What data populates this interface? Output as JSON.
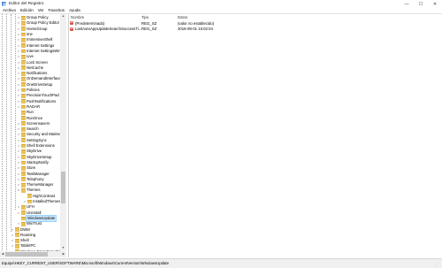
{
  "window": {
    "title": "Editor del Registro",
    "minimize": "—",
    "maximize": "☐",
    "close": "✕"
  },
  "menu": [
    "Archivo",
    "Edición",
    "Ver",
    "Favoritos",
    "Ayuda"
  ],
  "tree": {
    "items": [
      {
        "label": "Group Policy",
        "expander": ">",
        "selected": false
      },
      {
        "label": "Group Policy Editor",
        "expander": ">",
        "selected": false
      },
      {
        "label": "HomeGroup",
        "expander": ">",
        "selected": false
      },
      {
        "label": "ime",
        "expander": ">",
        "selected": false
      },
      {
        "label": "ImmersiveShell",
        "expander": ">",
        "selected": false
      },
      {
        "label": "Internet Settings",
        "expander": ">",
        "selected": false
      },
      {
        "label": "Internet SettingsWinds",
        "expander": ">",
        "selected": false
      },
      {
        "label": "Live",
        "expander": ">",
        "selected": false
      },
      {
        "label": "Lock Screen",
        "expander": ">",
        "selected": false
      },
      {
        "label": "NetCache",
        "expander": ">",
        "selected": false
      },
      {
        "label": "Notifications",
        "expander": ">",
        "selected": false
      },
      {
        "label": "OnDemandInterfaceC",
        "expander": ">",
        "selected": false
      },
      {
        "label": "OneDriveSetup",
        "expander": ">",
        "selected": false
      },
      {
        "label": "Policies",
        "expander": ">",
        "selected": false
      },
      {
        "label": "PrecisionTouchPad",
        "expander": ">",
        "selected": false
      },
      {
        "label": "PushNotifications",
        "expander": ">",
        "selected": false
      },
      {
        "label": "RADAR",
        "expander": ">",
        "selected": false
      },
      {
        "label": "Run",
        "expander": "",
        "selected": false
      },
      {
        "label": "RunOnce",
        "expander": "",
        "selected": false
      },
      {
        "label": "Screensavers",
        "expander": ">",
        "selected": false
      },
      {
        "label": "Search",
        "expander": ">",
        "selected": false
      },
      {
        "label": "Security and Mainteria",
        "expander": ">",
        "selected": false
      },
      {
        "label": "SettingSync",
        "expander": ">",
        "selected": false
      },
      {
        "label": "Shell Extensions",
        "expander": ">",
        "selected": false
      },
      {
        "label": "SkyDrive",
        "expander": ">",
        "selected": false
      },
      {
        "label": "SkyDriveSetup",
        "expander": ">",
        "selected": false
      },
      {
        "label": "StartupNotify",
        "expander": ">",
        "selected": false
      },
      {
        "label": "Store",
        "expander": ">",
        "selected": false
      },
      {
        "label": "TaskManager",
        "expander": ">",
        "selected": false
      },
      {
        "label": "Telephony",
        "expander": ">",
        "selected": false
      },
      {
        "label": "ThemeManager",
        "expander": ">",
        "selected": false
      },
      {
        "label": "Themes",
        "expander": "v",
        "selected": false
      },
      {
        "label": "HighContrast",
        "expander": "",
        "selected": false
      },
      {
        "label": "InstalledThemes",
        "expander": ">",
        "selected": false
      },
      {
        "label": "UFH",
        "expander": ">",
        "selected": false
      },
      {
        "label": "Uninstall",
        "expander": ">",
        "selected": false
      },
      {
        "label": "WindowsUpdate",
        "expander": "",
        "selected": true
      },
      {
        "label": "WinTrust",
        "expander": ">",
        "selected": false
      },
      {
        "label": "DWM",
        "expander": ">",
        "selected": false
      },
      {
        "label": "Roaming",
        "expander": ">",
        "selected": false
      },
      {
        "label": "Shell",
        "expander": ">",
        "selected": false
      },
      {
        "label": "TabletPC",
        "expander": ">",
        "selected": false
      },
      {
        "label": "Windows Error Reporting",
        "expander": ">",
        "selected": false
      },
      {
        "label": "Winlogon",
        "expander": ">",
        "selected": false
      }
    ]
  },
  "list": {
    "columns": [
      "Nombre",
      "Tipo",
      "Datos"
    ],
    "rows": [
      {
        "icon": "ab",
        "name": "(Predeterminado)",
        "type": "REG_SZ",
        "data": "(valor no establecido)"
      },
      {
        "icon": "ab",
        "name": "LastAutoAppUpdateSearchSuccessTi...",
        "type": "REG_SZ",
        "data": "2015-08-01 16:02:04"
      }
    ]
  },
  "status": {
    "path": "Equipo\\HKEY_CURRENT_USER\\SOFTWARE\\Microsoft\\Windows\\CurrentVersion\\WindowsUpdate"
  },
  "colors": {
    "folder": "#e8c15a",
    "selection": "#cce8ff",
    "reg_string_icon": "#d4544c"
  }
}
